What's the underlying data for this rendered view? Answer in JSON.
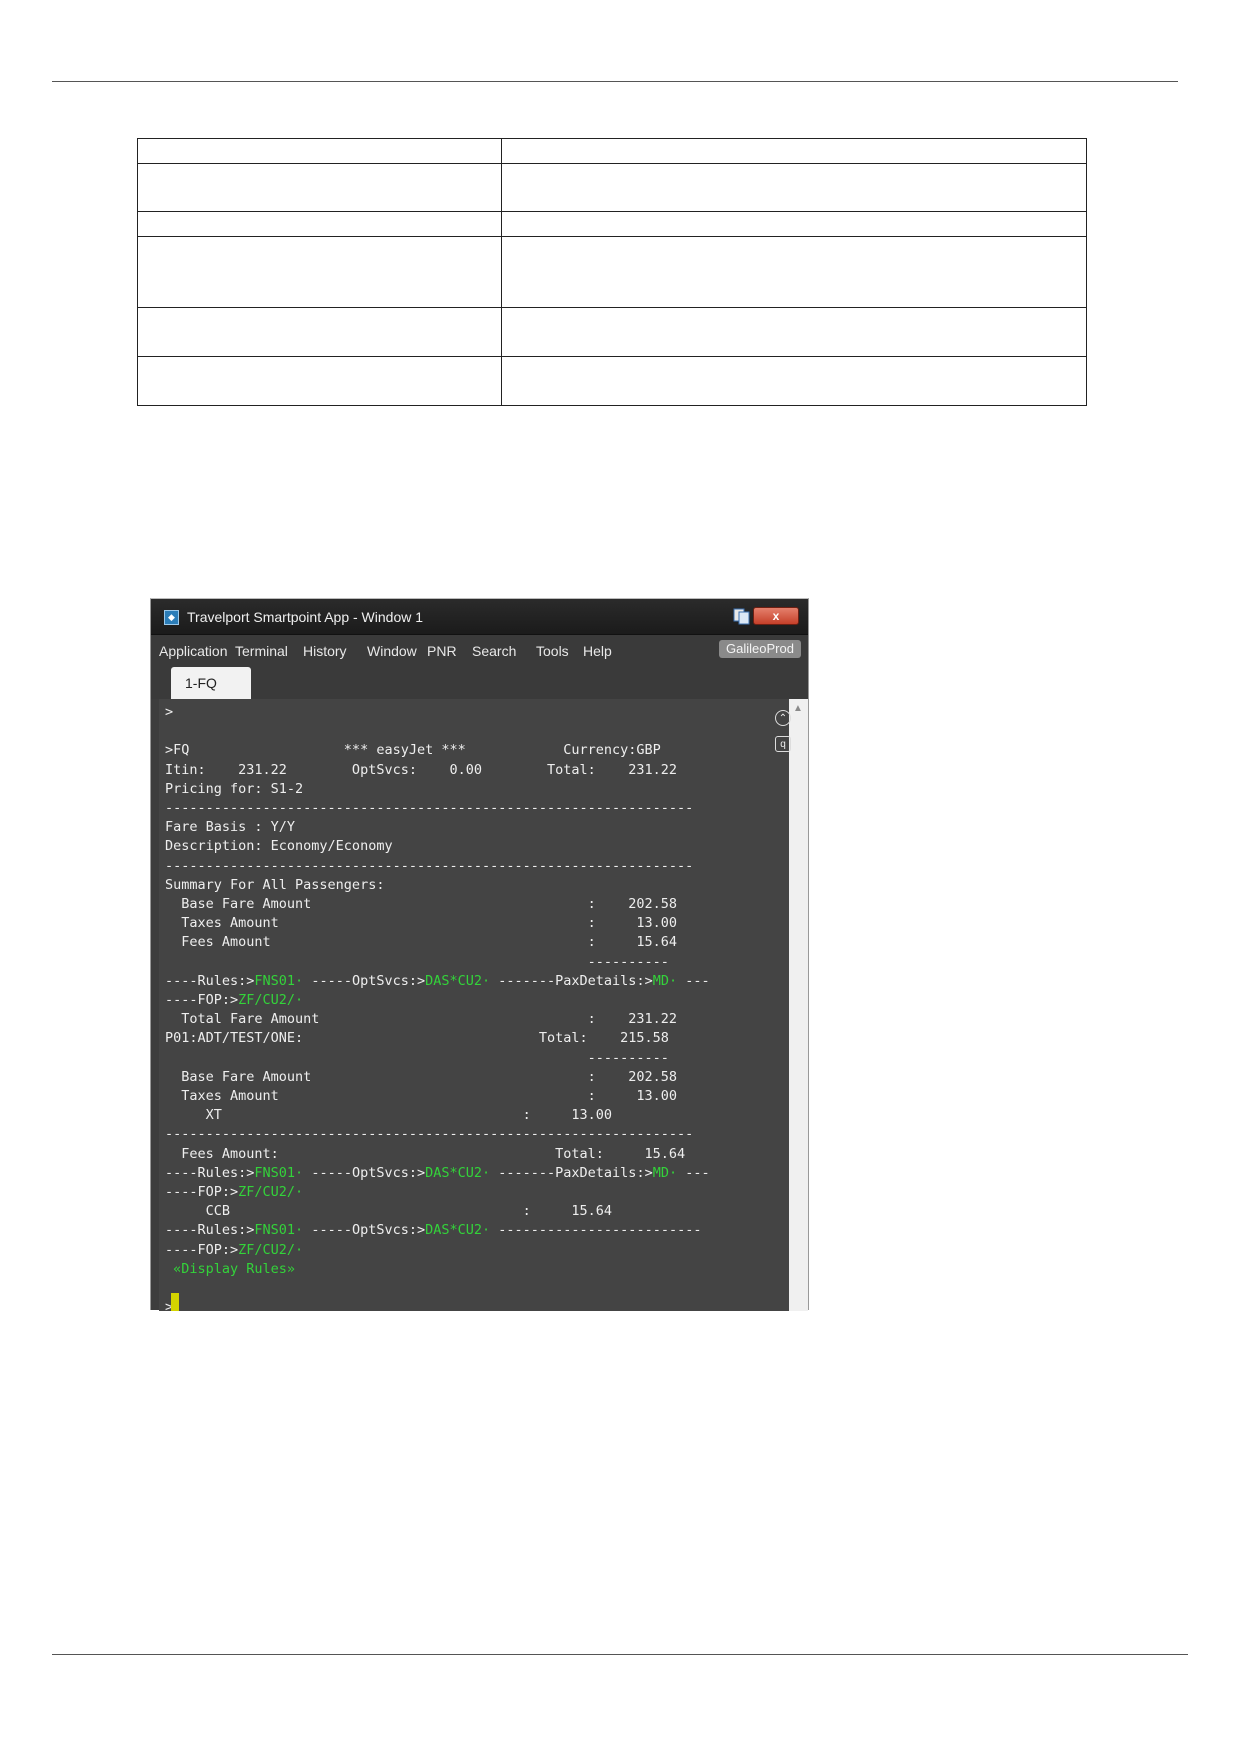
{
  "window": {
    "title": "Travelport Smartpoint App - Window 1",
    "close_label": "x",
    "environment": "GalileoProd"
  },
  "menu": [
    "Application",
    "Terminal",
    "History",
    "Window",
    "PNR",
    "Search",
    "Tools",
    "Help"
  ],
  "tabs": [
    {
      "label": "1-FQ"
    }
  ],
  "colors": {
    "terminal_bg": "#444444",
    "terminal_text": "#eeeeee",
    "link_green": "#33d33a"
  },
  "terminal": {
    "prompt": ">",
    "header": ">FQ                   *** easyJet ***            Currency:GBP",
    "itin": "Itin:    231.22        OptSvcs:    0.00        Total:    231.22",
    "pricing": "Pricing for: S1-2",
    "separator": "-----------------------------------------------------------------",
    "fare_basis": "Fare Basis : Y/Y",
    "description": "Description: Economy/Economy",
    "summary_title": "Summary For All Passengers:",
    "base_fare": "  Base Fare Amount                                  :    202.58",
    "taxes": "  Taxes Amount                                      :     13.00",
    "fees": "  Fees Amount                                       :     15.64",
    "sub_sep": "                                                    ----------",
    "rules_prefix": "----Rules:>",
    "rules_link": "FNS01·",
    "optsvcs_prefix": " -----OptSvcs:>",
    "optsvcs_link": "DAS*CU2·",
    "pax_prefix": " -------PaxDetails:>",
    "pax_link": "MD·",
    "pax_suffix": " ---",
    "fop_prefix": "----FOP:>",
    "fop_link": "ZF/CU2/·",
    "total_fare": "  Total Fare Amount                                 :    231.22",
    "pax_line": "P01:ADT/TEST/ONE:                             Total:    215.58",
    "base_fare2": "  Base Fare Amount                                  :    202.58",
    "taxes2": "  Taxes Amount                                      :     13.00",
    "xt": "     XT                                     :     13.00",
    "fees2": "  Fees Amount:                                  Total:     15.64",
    "ccb": "     CCB                                    :     15.64",
    "long_dash": " -------------------------",
    "display_rules": " «Display Rules»"
  }
}
